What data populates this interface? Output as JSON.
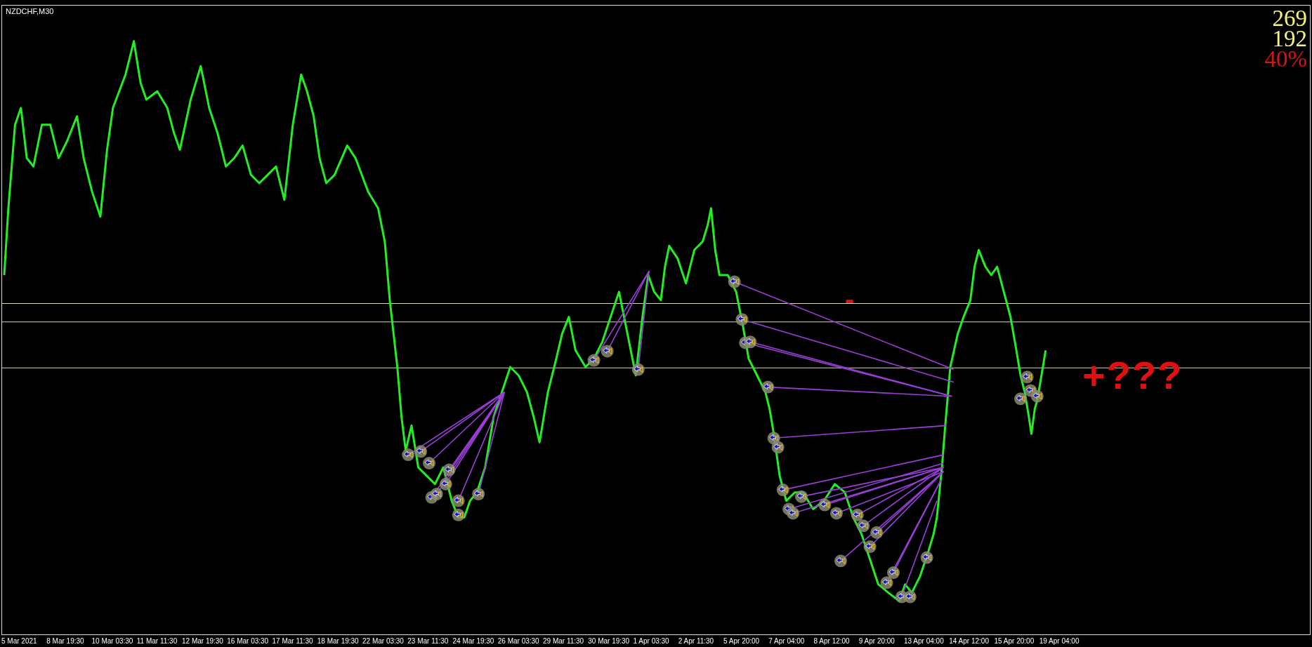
{
  "chart": {
    "symbol": "NZDCHF,M30"
  },
  "counters": [
    {
      "text": "269",
      "color": "#f2f27a"
    },
    {
      "text": "192",
      "color": "#f2f27a"
    },
    {
      "text": "40%",
      "color": "#e01010"
    }
  ],
  "annotations": [
    {
      "text": "-",
      "kind": "minus"
    },
    {
      "text": "+???",
      "kind": "plus"
    }
  ],
  "time_axis": [
    "5 Mar 2021",
    "8 Mar 19:30",
    "10 Mar 03:30",
    "11 Mar 11:30",
    "12 Mar 19:30",
    "16 Mar 03:30",
    "17 Mar 11:30",
    "18 Mar 19:30",
    "22 Mar 03:30",
    "23 Mar 11:30",
    "24 Mar 19:30",
    "26 Mar 03:30",
    "29 Mar 11:30",
    "30 Mar 19:30",
    "1 Apr 03:30",
    "2 Apr 11:30",
    "5 Apr 20:00",
    "7 Apr 04:00",
    "8 Apr 12:00",
    "9 Apr 20:00",
    "13 Apr 04:00",
    "14 Apr 12:00",
    "15 Apr 20:00",
    "19 Apr 04:00"
  ]
}
